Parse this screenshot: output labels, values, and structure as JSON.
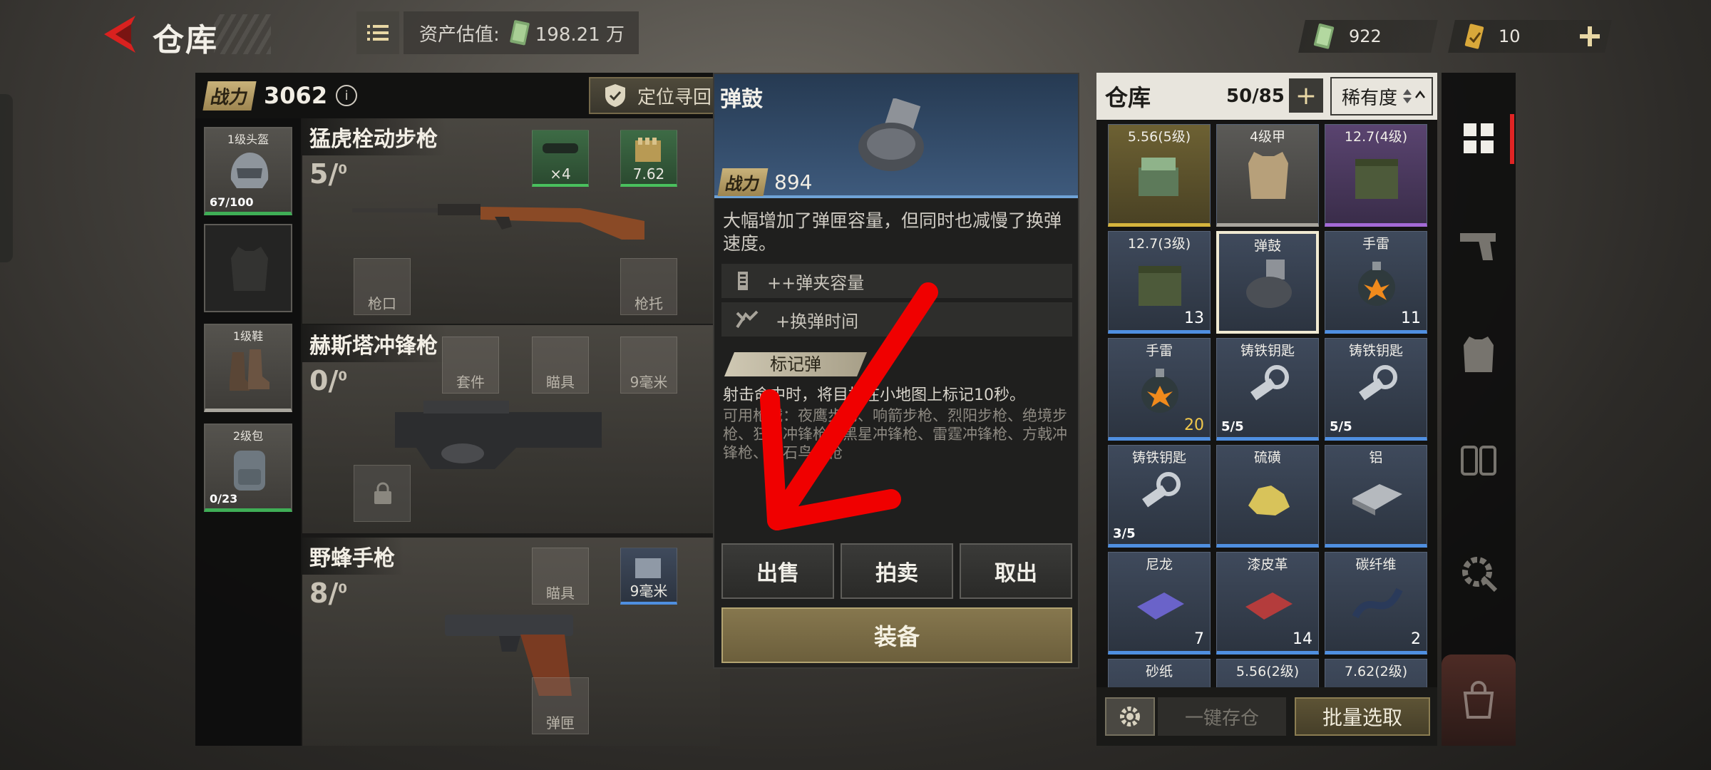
{
  "header": {
    "title": "仓库",
    "asset_label": "资产估值:",
    "asset_value": "198.21 万",
    "currency_cash": "922",
    "currency_ticket": "10"
  },
  "loadout": {
    "power_label": "战力",
    "power_value": "3062",
    "locate_label": "定位寻回",
    "gear": [
      {
        "label": "1级头盔",
        "count": "67/100"
      },
      {
        "label": "",
        "count": ""
      },
      {
        "label": "1级鞋",
        "count": ""
      },
      {
        "label": "2级包",
        "count": "0/23"
      }
    ],
    "weapons": [
      {
        "name": "猛虎栓动步枪",
        "ammo": "5/",
        "reserve": "0",
        "slots": {
          "scope_qty": "×4",
          "ammo_type": "7.62",
          "muzzle": "枪口",
          "stock": "枪托"
        }
      },
      {
        "name": "赫斯塔冲锋枪",
        "ammo": "0/",
        "reserve": "0",
        "slots": {
          "kit": "套件",
          "sight": "瞄具",
          "ammo_type": "9毫米"
        }
      },
      {
        "name": "野蜂手枪",
        "ammo": "8/",
        "reserve": "0",
        "slots": {
          "sight": "瞄具",
          "ammo_type": "9毫米",
          "mag": "弹匣"
        }
      }
    ]
  },
  "detail": {
    "title": "弹鼓",
    "power_label": "战力",
    "power_value": "894",
    "description": "大幅增加了弹匣容量，但同时也减慢了换弹速度。",
    "stats": [
      "++弹夹容量",
      "+换弹时间"
    ],
    "tag": "标记弹",
    "tag_desc": "射击命中时，将目标在小地图上标记10秒。",
    "guns_desc": "可用枪械：夜鹰步枪、响箭步枪、烈阳步枪、绝境步枪、狂澜冲锋枪、黑星冲锋枪、雷霆冲锋枪、方戟冲锋枪、钻石鸟手枪",
    "btn_sell": "出售",
    "btn_auction": "拍卖",
    "btn_take": "取出",
    "btn_equip": "装备"
  },
  "inventory": {
    "title": "仓库",
    "count": "50/85",
    "sort_label": "稀有度",
    "items": [
      {
        "name": "5.56(5级)",
        "qty": "",
        "rarity": "gold"
      },
      {
        "name": "4级甲",
        "qty": "",
        "rarity": "gray"
      },
      {
        "name": "12.7(4级)",
        "qty": "",
        "rarity": "purple"
      },
      {
        "name": "12.7(3级)",
        "qty": "13",
        "rarity": "blue"
      },
      {
        "name": "弹鼓",
        "qty": "",
        "rarity": "blue"
      },
      {
        "name": "手雷",
        "qty": "11",
        "rarity": "blue"
      },
      {
        "name": "手雷",
        "qty": "20",
        "rarity": "blue"
      },
      {
        "name": "铸铁钥匙",
        "qty": "5/5",
        "rarity": "blue"
      },
      {
        "name": "铸铁钥匙",
        "qty": "5/5",
        "rarity": "blue"
      },
      {
        "name": "铸铁钥匙",
        "qty": "3/5",
        "rarity": "blue"
      },
      {
        "name": "硫磺",
        "qty": "",
        "rarity": "blue"
      },
      {
        "name": "铝",
        "qty": "",
        "rarity": "blue"
      },
      {
        "name": "尼龙",
        "qty": "7",
        "rarity": "blue"
      },
      {
        "name": "漆皮革",
        "qty": "14",
        "rarity": "blue"
      },
      {
        "name": "碳纤维",
        "qty": "2",
        "rarity": "blue"
      },
      {
        "name": "砂纸",
        "qty": "",
        "rarity": "blue"
      },
      {
        "name": "5.56(2级)",
        "qty": "",
        "rarity": "blue"
      },
      {
        "name": "7.62(2级)",
        "qty": "",
        "rarity": "blue"
      }
    ],
    "store_all": "一键存仓",
    "batch_select": "批量选取"
  },
  "colors": {
    "accent_red": "#e02424",
    "gold": "#d6b43c",
    "rarity_blue": "#4f8fe0",
    "rarity_purple": "#a46ad6",
    "green_slot": "#3fae56",
    "arrow_red": "#f00000"
  },
  "icons": [
    "back-arrow-icon",
    "menu-icon",
    "cash-icon",
    "ticket-icon",
    "plus-icon",
    "info-icon",
    "shield-icon",
    "grid-icon",
    "pistol-icon",
    "vest-icon",
    "storage-icon",
    "settings-gear-icon",
    "bag-icon"
  ]
}
